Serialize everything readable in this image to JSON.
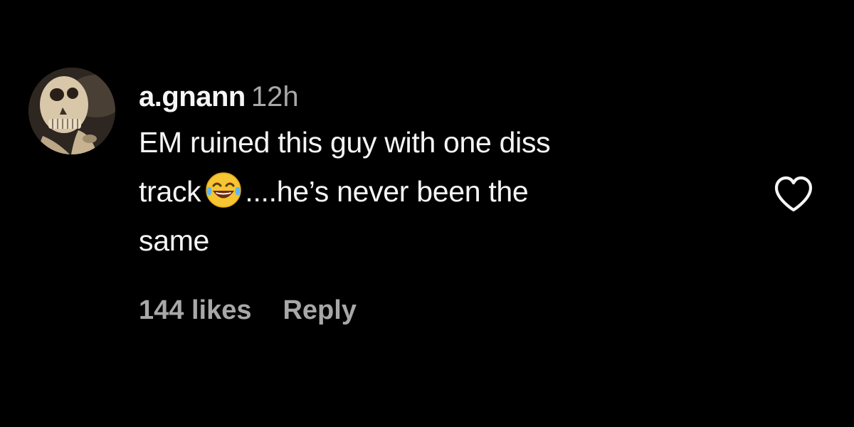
{
  "comment": {
    "username": "a.gnann",
    "timestamp": "12h",
    "text_line_1": "EM ruined this guy with one diss",
    "text_line_2_before": "track",
    "text_line_2_emoji": "face-with-tears-of-joy-emoji",
    "text_line_2_after": "....he’s never been the",
    "text_line_3": "same",
    "likes": "144 likes",
    "reply_label": "Reply",
    "like_icon": "heart-outline-icon",
    "avatar": "skeleton-avatar"
  },
  "colors": {
    "background": "#000000",
    "primary_text": "#f5f5f5",
    "secondary_text": "#a8a8a8"
  }
}
